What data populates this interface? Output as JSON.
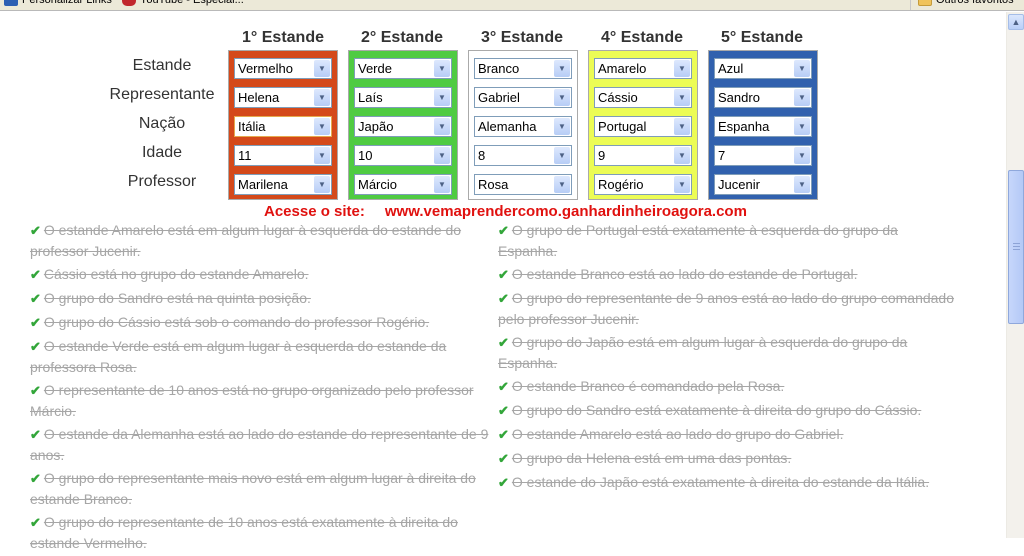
{
  "bookmarks": {
    "left": [
      {
        "label": "Personalizar Links",
        "icon": "links-icon",
        "color": "#2c5fb3"
      },
      {
        "label": "YouTube - Especial...",
        "icon": "youtube-icon",
        "color": "#c1272d"
      }
    ],
    "right": {
      "label": "Outros favoritos",
      "icon": "folder-icon",
      "color": "#f0c35a"
    }
  },
  "puzzle": {
    "columns": [
      "1° Estande",
      "2° Estande",
      "3° Estande",
      "4° Estande",
      "5° Estande"
    ],
    "row_labels": [
      "Estande",
      "Representante",
      "Nação",
      "Idade",
      "Professor"
    ],
    "stands": [
      {
        "bg": "#d4491a",
        "values": [
          "Vermelho",
          "Helena",
          "Itália",
          "11",
          "Marilena"
        ]
      },
      {
        "bg": "#4fcb42",
        "values": [
          "Verde",
          "Laís",
          "Japão",
          "10",
          "Márcio"
        ]
      },
      {
        "bg": "#ffffff",
        "values": [
          "Branco",
          "Gabriel",
          "Alemanha",
          "8",
          "Rosa"
        ]
      },
      {
        "bg": "#ecfc55",
        "values": [
          "Amarelo",
          "Cássio",
          "Portugal",
          "9",
          "Rogério"
        ]
      },
      {
        "bg": "#3161ae",
        "values": [
          "Azul",
          "Sandro",
          "Espanha",
          "7",
          "Jucenir"
        ]
      }
    ]
  },
  "promo": {
    "label": "Acesse o site:",
    "url": "www.vemaprendercomo.ganhardinheiroagora.com"
  },
  "clues_left": [
    "O estande Amarelo está em algum lugar à esquerda do estande do professor Jucenir.",
    "Cássio está no grupo do estande Amarelo.",
    "O grupo do Sandro está na quinta posição.",
    "O grupo do Cássio está sob o comando do professor Rogério.",
    "O estande Verde está em algum lugar à esquerda do estande da professora Rosa.",
    "O representante de 10 anos está no grupo organizado pelo professor Márcio.",
    "O estande da Alemanha está ao lado do estande do representante de 9 anos.",
    "O grupo do representante mais novo está em algum lugar à direita do estande Branco.",
    "O grupo do representante de 10 anos está exatamente à direita do estande Vermelho."
  ],
  "clues_right": [
    "O grupo de Portugal está exatamente à esquerda do grupo da Espanha.",
    "O estande Branco está ao lado do estande de Portugal.",
    "O grupo do representante de 9 anos está ao lado do grupo comandado pelo professor Jucenir.",
    "O grupo do Japão está em algum lugar à esquerda do grupo da Espanha.",
    "O estande Branco é comandado pela Rosa.",
    "O grupo do Sandro está exatamente à direita do grupo do Cássio.",
    "O estande Amarelo está ao lado do grupo do Gabriel.",
    "O grupo da Helena está em uma das pontas.",
    "O estande do Japão está exatamente à direita do estande da Itália."
  ],
  "check_glyph": "✔"
}
